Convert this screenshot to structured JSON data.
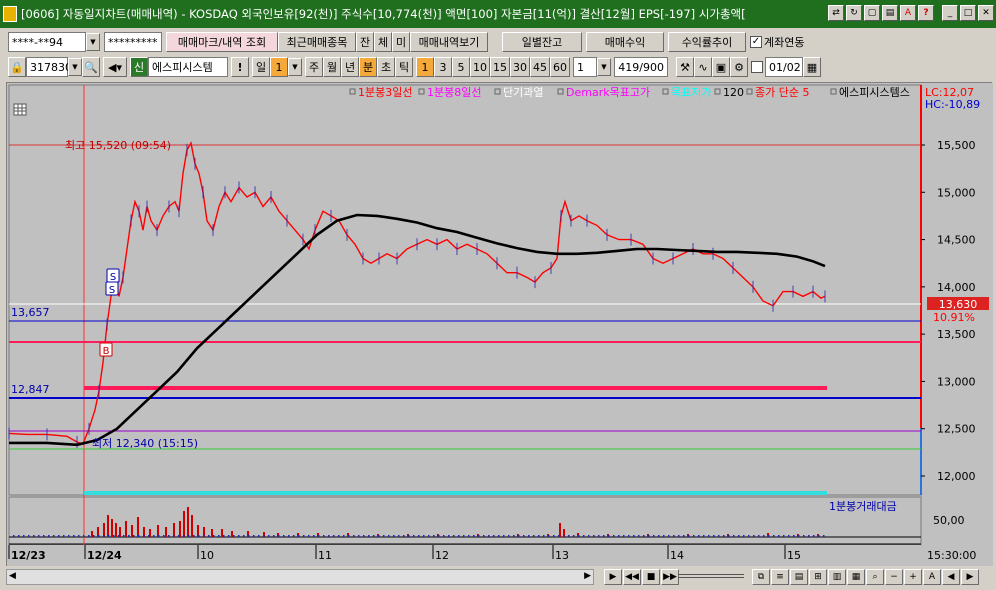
{
  "window": {
    "title": "[0606] 자동일지차트(매매내역) - KOSDAQ 외국인보유[92(천)] 주식수[10,774(천)] 액면[100] 자본금[11(억)] 결산[12월] EPS[-197] 시가총액["
  },
  "toolbar1": {
    "account": "****-**94",
    "password": "*********",
    "trade_mark_btn": "매매마크/내역 조회",
    "recent_trades_btn": "최근매매종목",
    "jan_btn": "잔",
    "che_btn": "체",
    "mi_btn": "미",
    "trade_history_btn": "매매내역보기",
    "daily_balance_btn": "일별잔고",
    "trade_profit_btn": "매매수익",
    "return_trend_btn": "수익률추이",
    "account_link_label": "계좌연동",
    "account_link_checked": true
  },
  "toolbar2": {
    "stock_code": "317830",
    "stock_name": "에스피시스템",
    "period_labels": [
      "일",
      "주",
      "월",
      "년",
      "분",
      "초",
      "틱"
    ],
    "period_selected": "분",
    "day_count": "1",
    "interval_options": [
      "1",
      "3",
      "5",
      "10",
      "15",
      "30",
      "45",
      "60"
    ],
    "interval_selected": "1",
    "interval_value": "1",
    "count_display": "419/900",
    "date_value": "01/02"
  },
  "chart": {
    "legend": [
      {
        "label": "1분봉3일선",
        "color": "#ff0000"
      },
      {
        "label": "1분봉8일선",
        "color": "#ff00ff"
      },
      {
        "label": "단기과열",
        "color": "#ffffff"
      },
      {
        "label": "Demark목표고가",
        "color": "#ff00ff"
      },
      {
        "label": "목표저가",
        "color": "#00ffff"
      },
      {
        "label": "120",
        "color": "#000000"
      },
      {
        "label": "종가 단순 5",
        "color": "#ff0000"
      },
      {
        "label": "에스피시스템스",
        "color": "#000000"
      }
    ],
    "lc_label": "LC:12,07",
    "hc_label": "HC:-10,89",
    "price_ticks": [
      "15,500",
      "15,000",
      "14,500",
      "14,000",
      "13,500",
      "13,000",
      "12,500",
      "12,000"
    ],
    "current_price": "13,630",
    "change_pct": "10.91%",
    "high_annotation": "최고 15,520 (09:54)",
    "low_annotation": "최저 12,340 (15:15)",
    "level_labels": [
      "13,657",
      "12,847"
    ],
    "volume_legend": "1분봉거래대금",
    "volume_tick": "50,00",
    "date_labels": [
      "12/23",
      "12/24",
      "10",
      "11",
      "12",
      "13",
      "14",
      "15"
    ],
    "time_label": "15:30:00",
    "trade_markers": [
      "S",
      "S",
      "B"
    ],
    "colors": {
      "price_line": "#ff0000",
      "ma_line": "#000000",
      "level_blue": "#0000cc",
      "level_pink": "#ff1a5a",
      "level_purple": "#9900cc",
      "level_green": "#33cc33",
      "level_cyan": "#33dddd",
      "axis_red": "#ff0000"
    }
  }
}
